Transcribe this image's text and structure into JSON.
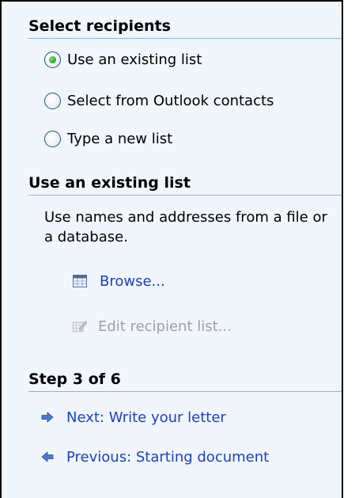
{
  "select_recipients": {
    "title": "Select recipients",
    "options": [
      {
        "label": "Use an existing list",
        "selected": true
      },
      {
        "label": "Select from Outlook contacts",
        "selected": false
      },
      {
        "label": "Type a new list",
        "selected": false
      }
    ]
  },
  "existing_list": {
    "title": "Use an existing list",
    "description": "Use names and addresses from a file or a database.",
    "browse_label": "Browse...",
    "edit_label": "Edit recipient list..."
  },
  "step": {
    "title": "Step 3 of 6",
    "next_label": "Next: Write your letter",
    "previous_label": "Previous: Starting document"
  },
  "colors": {
    "pane_background": "#f1f6fd",
    "link": "#1a3fd0",
    "disabled": "#a0a0a0",
    "separator": "#8fb0e6"
  },
  "icons": {
    "browse": "table-icon",
    "edit": "edit-list-icon",
    "next": "arrow-right-icon",
    "previous": "arrow-left-icon"
  }
}
